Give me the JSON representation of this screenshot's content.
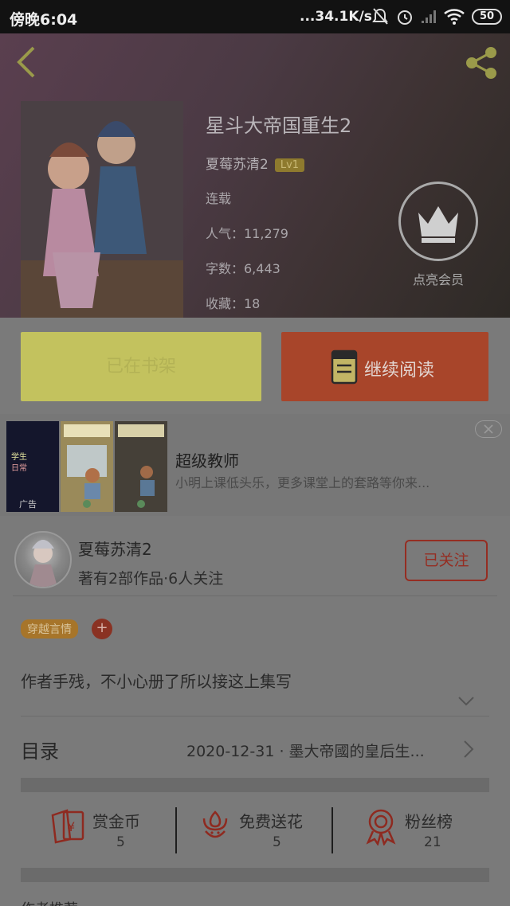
{
  "status_bar": {
    "time": "傍晚6:04",
    "network_speed": "...34.1K/s",
    "battery": "50"
  },
  "book": {
    "title": "星斗大帝国重生2",
    "author": "夏莓苏清2",
    "level": "Lv1",
    "status": "连载",
    "popularity": "人气：11,279",
    "word_count": "字数：6,443",
    "favorites": "收藏：18"
  },
  "vip": {
    "label": "点亮会员"
  },
  "buttons": {
    "shelf": "已在书架",
    "read": "继续阅读"
  },
  "ad": {
    "title": "超级教师",
    "description": "小明上课低头乐，更多课堂上的套路等你来...",
    "badge": "广告"
  },
  "author_card": {
    "name": "夏莓苏清2",
    "summary": "著有2部作品·6人关注",
    "follow": "已关注"
  },
  "tags": [
    "穿越言情"
  ],
  "tag_add": "+",
  "synopsis": "作者手残，不小心册了所以接这上集写",
  "toc": {
    "label": "目录",
    "latest": "2020-12-31 · 墨大帝國的皇后生..."
  },
  "stats": [
    {
      "label": "赏金币",
      "value": "5",
      "icon": "red-envelope-icon"
    },
    {
      "label": "免费送花",
      "value": "5",
      "icon": "flower-icon"
    },
    {
      "label": "粉丝榜",
      "value": "21",
      "icon": "medal-icon"
    }
  ],
  "next_section": "作者推荐"
}
